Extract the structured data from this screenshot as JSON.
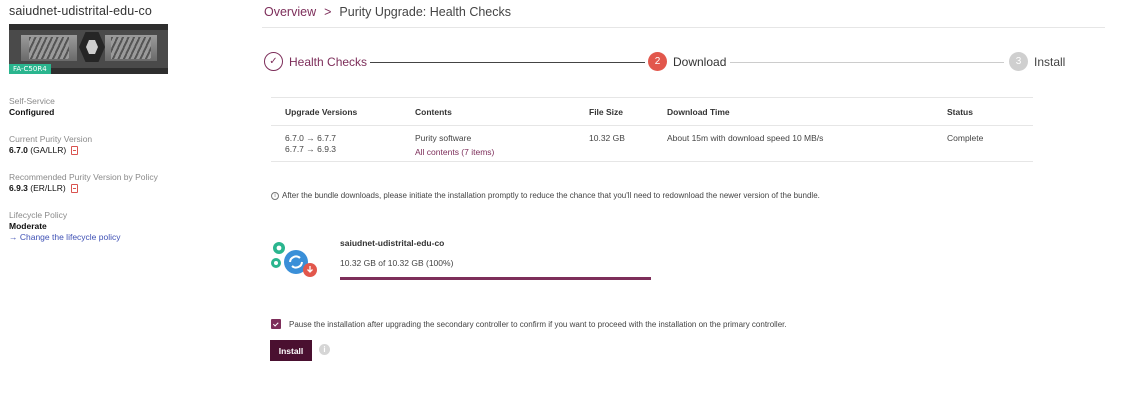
{
  "sidebar": {
    "array_name": "saiudnet-udistrital-edu-co",
    "model_badge": "FA-C50R4",
    "self_service": {
      "label": "Self-Service",
      "value": "Configured"
    },
    "current_version": {
      "label": "Current Purity Version",
      "value": "6.7.0",
      "suffix": "(GA/LLR)"
    },
    "recommended_version": {
      "label": "Recommended Purity Version by Policy",
      "value": "6.9.3",
      "suffix": "(ER/LLR)"
    },
    "lifecycle": {
      "label": "Lifecycle Policy",
      "value": "Moderate",
      "link": "→  Change the lifecycle policy"
    }
  },
  "breadcrumb": {
    "root": "Overview",
    "separator": ">",
    "current": "Purity Upgrade: Health Checks"
  },
  "steps": [
    {
      "number": "✓",
      "label": "Health Checks",
      "state": "done"
    },
    {
      "number": "2",
      "label": "Download",
      "state": "active"
    },
    {
      "number": "3",
      "label": "Install",
      "state": "pending"
    }
  ],
  "table": {
    "headers": [
      "Upgrade Versions",
      "Contents",
      "File Size",
      "Download Time",
      "Status"
    ],
    "row": {
      "versions": [
        "6.7.0 → 6.7.7",
        "6.7.7 → 6.9.3"
      ],
      "contents": "Purity software",
      "contents_link": "All contents (7 items)",
      "file_size": "10.32 GB",
      "download_time": "About 15m with download speed 10 MB/s",
      "status": "Complete"
    }
  },
  "note": "After the bundle downloads, please initiate the installation promptly to reduce the chance that you'll need to redownload the newer version of the bundle.",
  "download": {
    "name": "saiudnet-udistrital-edu-co",
    "size_text": "10.32 GB of 10.32 GB (100%)",
    "progress": 1.0
  },
  "pause_option": {
    "checked": true,
    "label": "Pause the installation after upgrading the secondary controller to confirm if you want to proceed with the installation on the primary controller."
  },
  "install_button": "Install",
  "colors": {
    "accent": "#7d2e5a",
    "button": "#4a1030",
    "active_step": "#e2574c",
    "badge": "#2ab58e"
  }
}
